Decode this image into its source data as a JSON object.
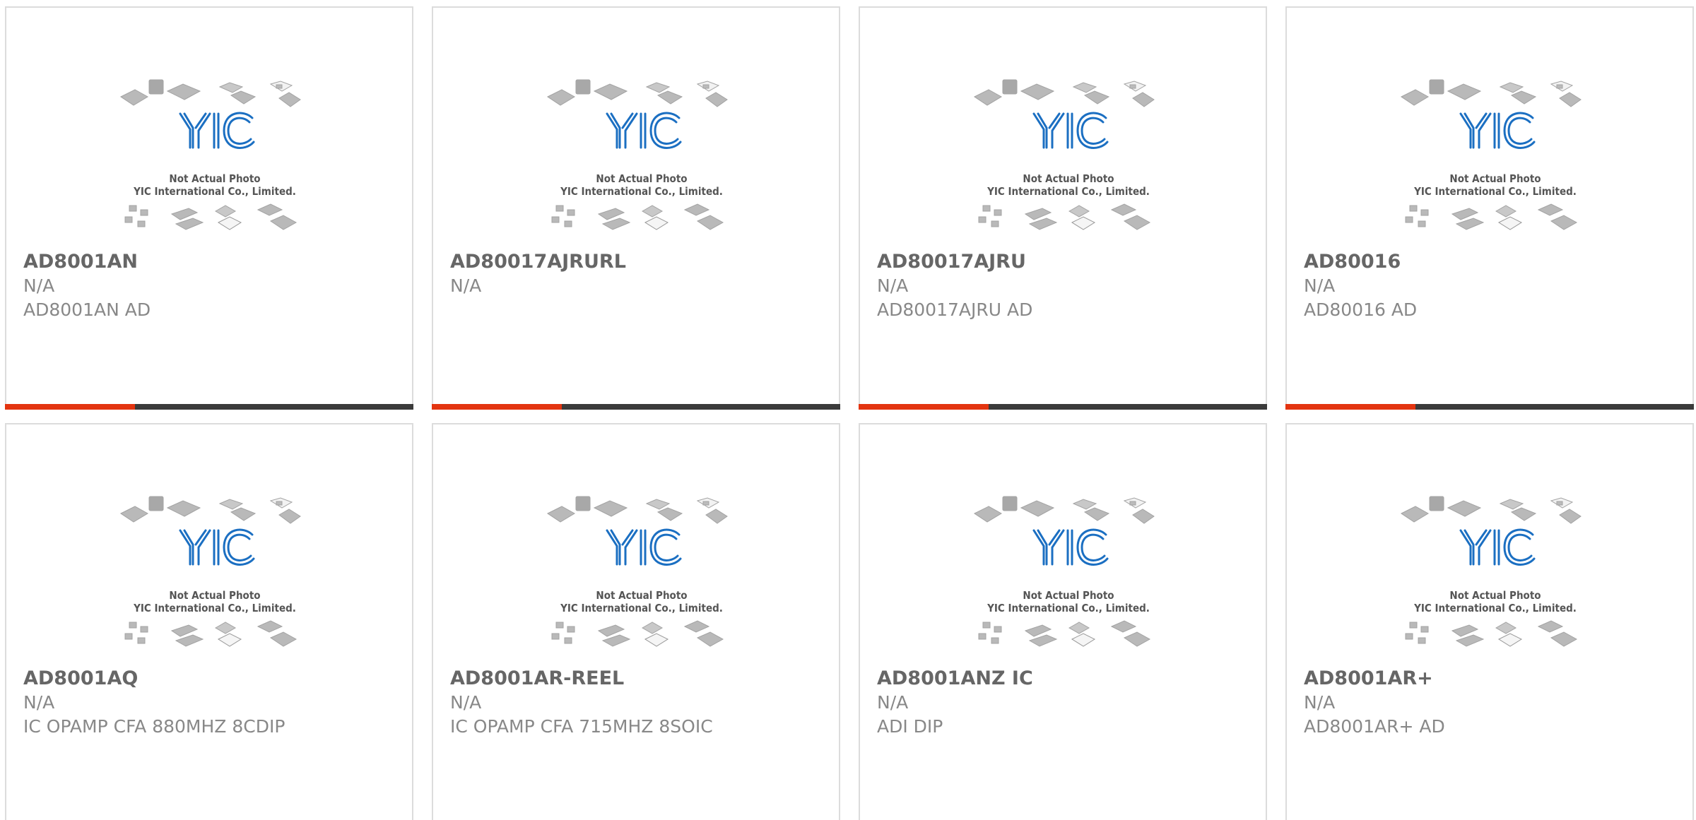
{
  "watermark": {
    "logo": "YIC",
    "line1": "Not Actual Photo",
    "line2": "YIC International Co., Limited."
  },
  "colors": {
    "accent": "#e33410",
    "bar_dark": "#3b3b3b",
    "logo_blue": "#1b6fc2"
  },
  "products": [
    {
      "part": "AD8001AN",
      "package": "N/A",
      "desc": "AD8001AN AD"
    },
    {
      "part": "AD80017AJRURL",
      "package": "N/A",
      "desc": ""
    },
    {
      "part": "AD80017AJRU",
      "package": "N/A",
      "desc": "AD80017AJRU AD"
    },
    {
      "part": "AD80016",
      "package": "N/A",
      "desc": "AD80016 AD"
    },
    {
      "part": "AD8001AQ",
      "package": "N/A",
      "desc": "IC OPAMP CFA 880MHZ 8CDIP"
    },
    {
      "part": "AD8001AR-REEL",
      "package": "N/A",
      "desc": "IC OPAMP CFA 715MHZ 8SOIC"
    },
    {
      "part": "AD8001ANZ IC",
      "package": "N/A",
      "desc": "ADI DIP"
    },
    {
      "part": "AD8001AR+",
      "package": "N/A",
      "desc": "AD8001AR+ AD"
    }
  ]
}
